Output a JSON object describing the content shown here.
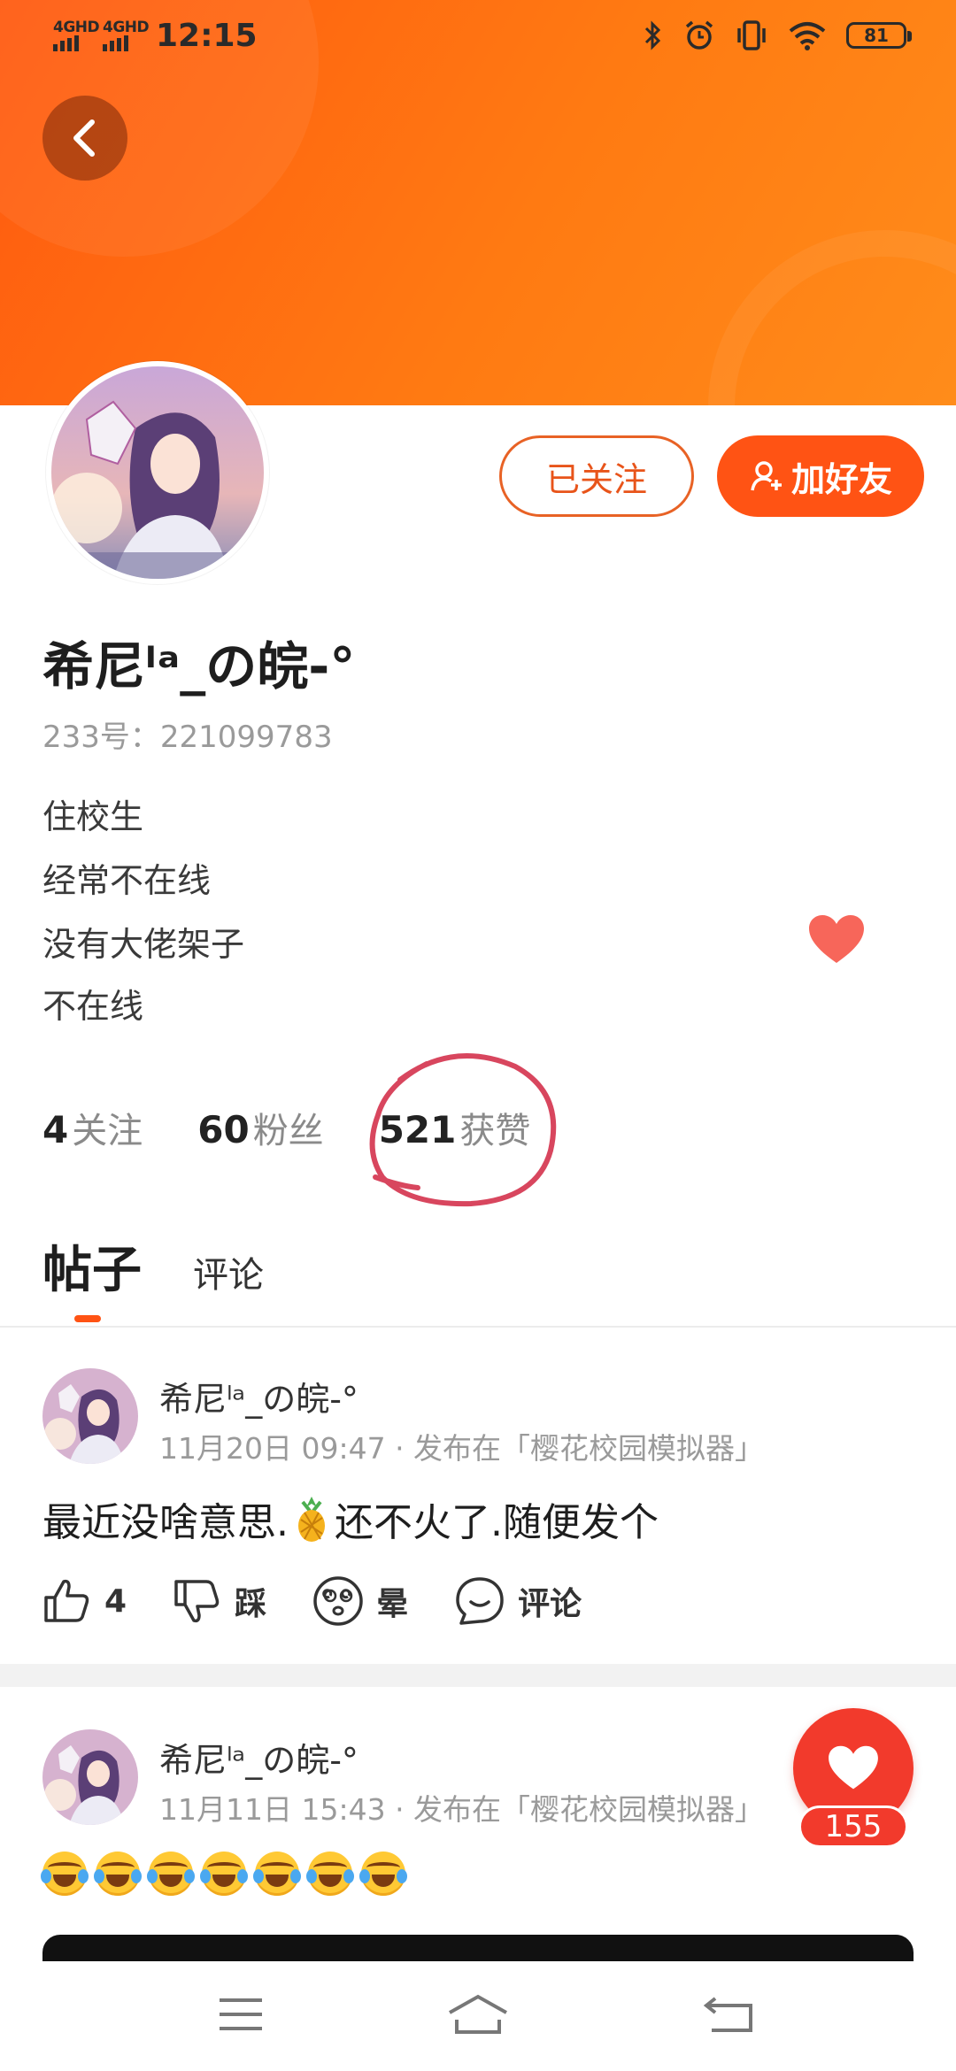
{
  "status_bar": {
    "signal1": "4GHD",
    "signal2": "4GHD",
    "time": "12:15",
    "battery": "81"
  },
  "profile": {
    "follow_state_label": "已关注",
    "add_friend_label": "加好友",
    "username": "希尼ˡᵃ_の皖-°",
    "id_line": "233号：221099783",
    "bio": [
      "住校生",
      "经常不在线",
      "没有大佬架子",
      "不在线"
    ],
    "stats": [
      {
        "value": "4",
        "label": "关注"
      },
      {
        "value": "60",
        "label": "粉丝"
      },
      {
        "value": "521",
        "label": "获赞"
      }
    ]
  },
  "tabs": [
    {
      "label": "帖子",
      "active": true
    },
    {
      "label": "评论",
      "active": false
    }
  ],
  "posts": [
    {
      "author": "希尼ˡᵃ_の皖-°",
      "meta": "11月20日 09:47 · 发布在「樱花校园模拟器」",
      "text_a": "最近没啥意思.",
      "text_b": "还不火了.随便发个",
      "actions": {
        "like": "4",
        "dislike": "踩",
        "dizzy": "晕",
        "comment": "评论"
      }
    },
    {
      "author": "希尼ˡᵃ_の皖-°",
      "meta": "11月11日 15:43 · 发布在「樱花校园模拟器」",
      "emoji_count": 7
    }
  ],
  "floating_like": {
    "count": "155"
  },
  "colors": {
    "accent": "#ff5314",
    "banner": "#ff6a10",
    "like_red": "#f23a2c"
  },
  "icons": [
    "back-arrow-icon",
    "heart-icon",
    "thumb-up-icon",
    "thumb-down-icon",
    "dizzy-face-icon",
    "comment-bubble-icon",
    "menu-icon",
    "home-icon",
    "return-icon"
  ]
}
